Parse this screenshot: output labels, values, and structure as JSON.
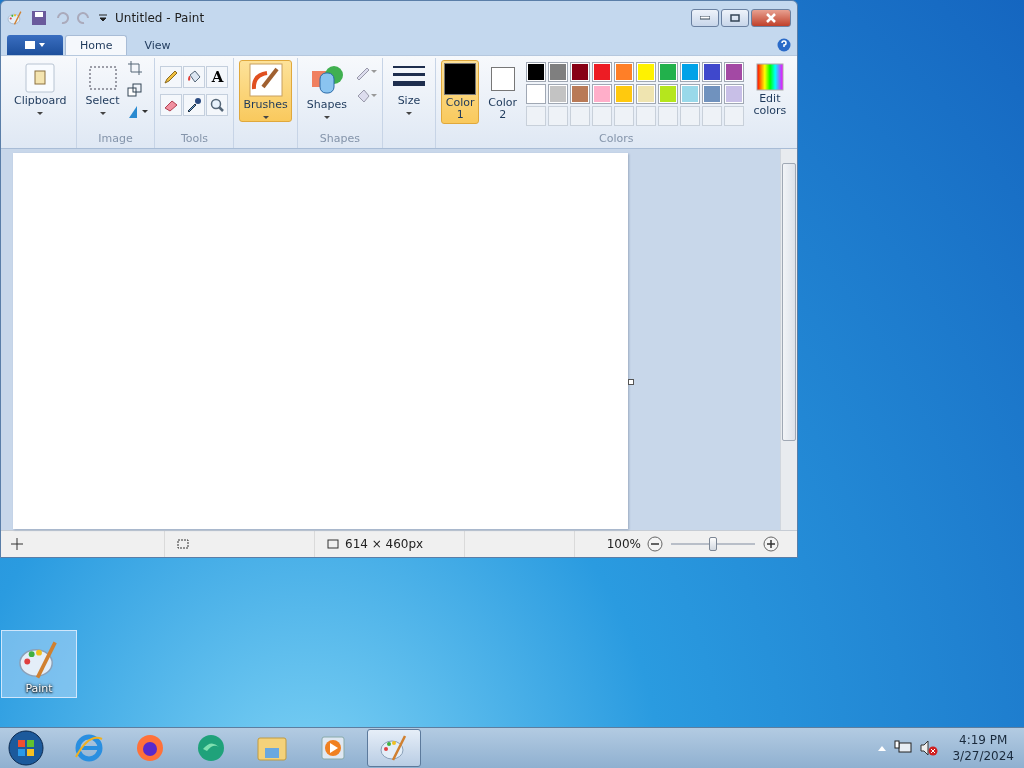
{
  "window": {
    "title": "Untitled - Paint",
    "tabs": [
      {
        "label": "Home",
        "selected": true
      },
      {
        "label": "View",
        "selected": false
      }
    ],
    "ribbon": {
      "clipboard": {
        "label": "Clipboard"
      },
      "image": {
        "select_label": "Select",
        "group_label": "Image"
      },
      "tools": {
        "items": [
          {
            "kind": "pencil"
          },
          {
            "kind": "fill"
          },
          {
            "kind": "text",
            "glyph": "A"
          },
          {
            "kind": "eraser"
          },
          {
            "kind": "picker"
          },
          {
            "kind": "magnifier"
          }
        ],
        "group_label": "Tools"
      },
      "brushes": {
        "label": "Brushes",
        "selected": true
      },
      "shapes": {
        "label": "Shapes",
        "group_label": "Shapes"
      },
      "size": {
        "label": "Size"
      },
      "colors": {
        "color_1": {
          "label": "Color 1",
          "color": "#000000",
          "selected": true
        },
        "color_2": {
          "label": "Color 2",
          "color": "#ffffff",
          "selected": false
        },
        "palette": [
          {
            "color": "#000000"
          },
          {
            "color": "#7f7f7f"
          },
          {
            "color": "#880015"
          },
          {
            "color": "#ed1c24"
          },
          {
            "color": "#ff7f27"
          },
          {
            "color": "#fff200"
          },
          {
            "color": "#22b14c"
          },
          {
            "color": "#00a2e8"
          },
          {
            "color": "#3f48cc"
          },
          {
            "color": "#a349a4"
          },
          {
            "color": "#ffffff"
          },
          {
            "color": "#c3c3c3"
          },
          {
            "color": "#b97a57"
          },
          {
            "color": "#ffaec9"
          },
          {
            "color": "#ffc90e"
          },
          {
            "color": "#efe4b0"
          },
          {
            "color": "#b5e61d"
          },
          {
            "color": "#99d9ea"
          },
          {
            "color": "#7092be"
          },
          {
            "color": "#c8bfe7"
          }
        ],
        "edit_label": "Edit colors",
        "group_label": "Colors"
      }
    },
    "status_bar": {
      "dimensions": "614 × 460px",
      "zoom": "100%",
      "zoom_level": {
        "level": 0.5
      }
    }
  },
  "desktop_icons": [
    {
      "label": "Paint",
      "selected": true
    }
  ],
  "taskbar": {
    "items": [
      {
        "kind": "ie",
        "selected": false
      },
      {
        "kind": "firefox",
        "selected": false
      },
      {
        "kind": "edge",
        "selected": false
      },
      {
        "kind": "folder",
        "selected": false
      },
      {
        "kind": "media",
        "selected": false
      },
      {
        "kind": "paint",
        "selected": true
      }
    ],
    "clock": {
      "time": "4:19 PM",
      "date": "3/27/2024"
    }
  }
}
